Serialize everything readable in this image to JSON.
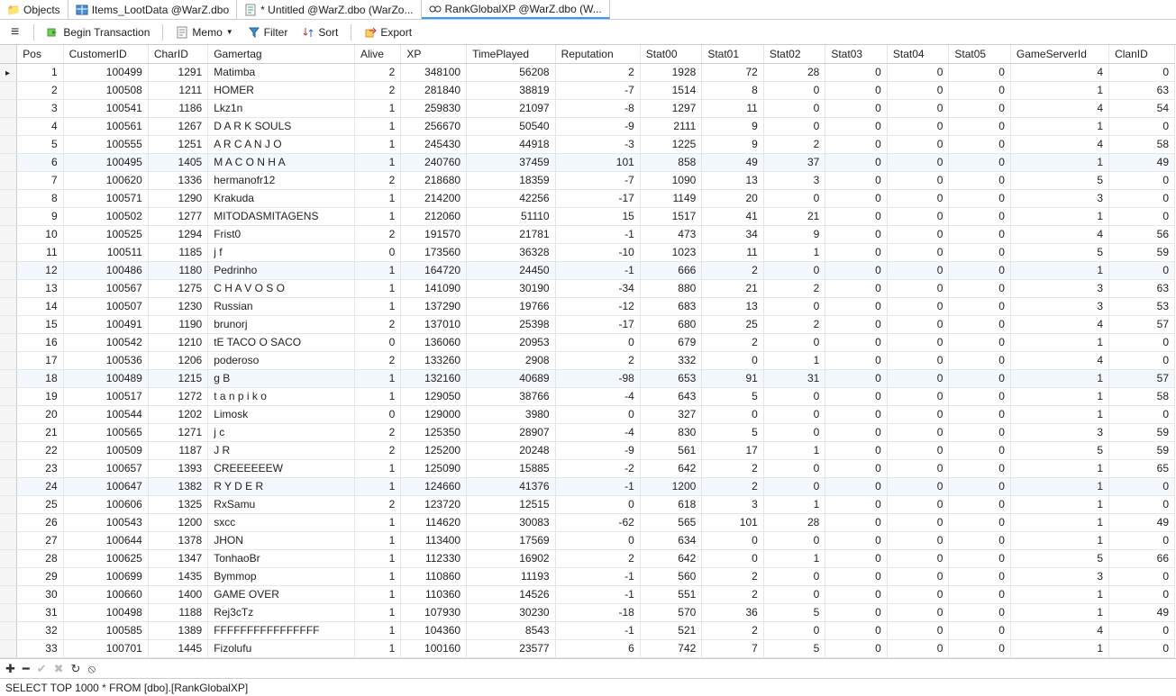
{
  "tabs": [
    {
      "label": "Objects"
    },
    {
      "label": "Items_LootData @WarZ.dbo"
    },
    {
      "label": "* Untitled @WarZ.dbo (WarZo..."
    },
    {
      "label": "RankGlobalXP @WarZ.dbo (W..."
    }
  ],
  "toolbar": {
    "begin": "Begin Transaction",
    "memo": "Memo",
    "filter": "Filter",
    "sort": "Sort",
    "export": "Export"
  },
  "columns": [
    "Pos",
    "CustomerID",
    "CharID",
    "Gamertag",
    "Alive",
    "XP",
    "TimePlayed",
    "Reputation",
    "Stat00",
    "Stat01",
    "Stat02",
    "Stat03",
    "Stat04",
    "Stat05",
    "GameServerId",
    "ClanID"
  ],
  "rows": [
    [
      1,
      100499,
      1291,
      "Matimba",
      2,
      348100,
      56208,
      2,
      1928,
      72,
      28,
      0,
      0,
      0,
      4,
      0
    ],
    [
      2,
      100508,
      1211,
      "HOMER",
      2,
      281840,
      38819,
      -7,
      1514,
      8,
      0,
      0,
      0,
      0,
      1,
      63
    ],
    [
      3,
      100541,
      1186,
      "Lkz1n",
      1,
      259830,
      21097,
      -8,
      1297,
      11,
      0,
      0,
      0,
      0,
      4,
      54
    ],
    [
      4,
      100561,
      1267,
      "D A R K SOULS",
      1,
      256670,
      50540,
      -9,
      2111,
      9,
      0,
      0,
      0,
      0,
      1,
      0
    ],
    [
      5,
      100555,
      1251,
      "A R C A N J O",
      1,
      245430,
      44918,
      -3,
      1225,
      9,
      2,
      0,
      0,
      0,
      4,
      58
    ],
    [
      6,
      100495,
      1405,
      "M A C O N H A",
      1,
      240760,
      37459,
      101,
      858,
      49,
      37,
      0,
      0,
      0,
      1,
      49
    ],
    [
      7,
      100620,
      1336,
      "hermanofr12",
      2,
      218680,
      18359,
      -7,
      1090,
      13,
      3,
      0,
      0,
      0,
      5,
      0
    ],
    [
      8,
      100571,
      1290,
      "Krakuda",
      1,
      214200,
      42256,
      -17,
      1149,
      20,
      0,
      0,
      0,
      0,
      3,
      0
    ],
    [
      9,
      100502,
      1277,
      "MITODASMITAGENS",
      1,
      212060,
      51110,
      15,
      1517,
      41,
      21,
      0,
      0,
      0,
      1,
      0
    ],
    [
      10,
      100525,
      1294,
      "Frist0",
      2,
      191570,
      21781,
      -1,
      473,
      34,
      9,
      0,
      0,
      0,
      4,
      56
    ],
    [
      11,
      100511,
      1185,
      "j  f",
      0,
      173560,
      36328,
      -10,
      1023,
      11,
      1,
      0,
      0,
      0,
      5,
      59
    ],
    [
      12,
      100486,
      1180,
      "Pedrinho",
      1,
      164720,
      24450,
      -1,
      666,
      2,
      0,
      0,
      0,
      0,
      1,
      0
    ],
    [
      13,
      100567,
      1275,
      "C H A V O S O",
      1,
      141090,
      30190,
      -34,
      880,
      21,
      2,
      0,
      0,
      0,
      3,
      63
    ],
    [
      14,
      100507,
      1230,
      "Russian",
      1,
      137290,
      19766,
      -12,
      683,
      13,
      0,
      0,
      0,
      0,
      3,
      53
    ],
    [
      15,
      100491,
      1190,
      "brunorj",
      2,
      137010,
      25398,
      -17,
      680,
      25,
      2,
      0,
      0,
      0,
      4,
      57
    ],
    [
      16,
      100542,
      1210,
      "tE TACO O SACO",
      0,
      136060,
      20953,
      0,
      679,
      2,
      0,
      0,
      0,
      0,
      1,
      0
    ],
    [
      17,
      100536,
      1206,
      "poderoso",
      2,
      133260,
      2908,
      2,
      332,
      0,
      1,
      0,
      0,
      0,
      4,
      0
    ],
    [
      18,
      100489,
      1215,
      "g B",
      1,
      132160,
      40689,
      -98,
      653,
      91,
      31,
      0,
      0,
      0,
      1,
      57
    ],
    [
      19,
      100517,
      1272,
      "t a n p i k o",
      1,
      129050,
      38766,
      -4,
      643,
      5,
      0,
      0,
      0,
      0,
      1,
      58
    ],
    [
      20,
      100544,
      1202,
      "Limosk",
      0,
      129000,
      3980,
      0,
      327,
      0,
      0,
      0,
      0,
      0,
      1,
      0
    ],
    [
      21,
      100565,
      1271,
      "j c",
      2,
      125350,
      28907,
      -4,
      830,
      5,
      0,
      0,
      0,
      0,
      3,
      59
    ],
    [
      22,
      100509,
      1187,
      "J R",
      2,
      125200,
      20248,
      -9,
      561,
      17,
      1,
      0,
      0,
      0,
      5,
      59
    ],
    [
      23,
      100657,
      1393,
      "CREEEEEEW",
      1,
      125090,
      15885,
      -2,
      642,
      2,
      0,
      0,
      0,
      0,
      1,
      65
    ],
    [
      24,
      100647,
      1382,
      "R Y D E R",
      1,
      124660,
      41376,
      -1,
      1200,
      2,
      0,
      0,
      0,
      0,
      1,
      0
    ],
    [
      25,
      100606,
      1325,
      "RxSamu",
      2,
      123720,
      12515,
      0,
      618,
      3,
      1,
      0,
      0,
      0,
      1,
      0
    ],
    [
      26,
      100543,
      1200,
      "sxcc",
      1,
      114620,
      30083,
      -62,
      565,
      101,
      28,
      0,
      0,
      0,
      1,
      49
    ],
    [
      27,
      100644,
      1378,
      "JHON",
      1,
      113400,
      17569,
      0,
      634,
      0,
      0,
      0,
      0,
      0,
      1,
      0
    ],
    [
      28,
      100625,
      1347,
      "TonhaoBr",
      1,
      112330,
      16902,
      2,
      642,
      0,
      1,
      0,
      0,
      0,
      5,
      66
    ],
    [
      29,
      100699,
      1435,
      "Bymmop",
      1,
      110860,
      11193,
      -1,
      560,
      2,
      0,
      0,
      0,
      0,
      3,
      0
    ],
    [
      30,
      100660,
      1400,
      "GAME OVER",
      1,
      110360,
      14526,
      -1,
      551,
      2,
      0,
      0,
      0,
      0,
      1,
      0
    ],
    [
      31,
      100498,
      1188,
      "Rej3cTz",
      1,
      107930,
      30230,
      -18,
      570,
      36,
      5,
      0,
      0,
      0,
      1,
      49
    ],
    [
      32,
      100585,
      1389,
      "FFFFFFFFFFFFFFFF",
      1,
      104360,
      8543,
      -1,
      521,
      2,
      0,
      0,
      0,
      0,
      4,
      0
    ],
    [
      33,
      100701,
      1445,
      "Fizolufu",
      1,
      100160,
      23577,
      6,
      742,
      7,
      5,
      0,
      0,
      0,
      1,
      0
    ]
  ],
  "status": "SELECT TOP 1000  * FROM [dbo].[RankGlobalXP]"
}
